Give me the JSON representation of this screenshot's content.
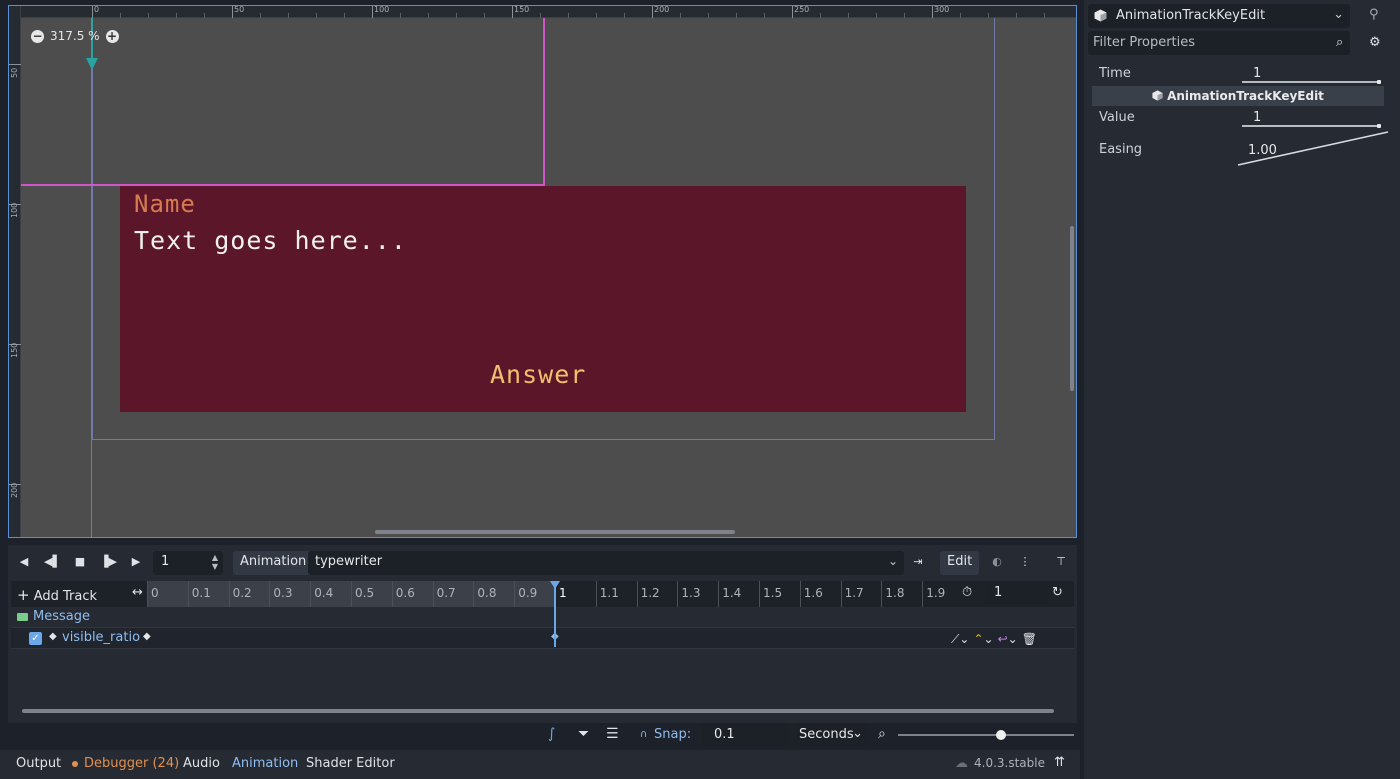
{
  "viewport": {
    "zoom_label": "317.5 %",
    "ruler_top_labels": [
      "0",
      "50",
      "100",
      "150",
      "200",
      "250",
      "300"
    ],
    "ruler_left_labels": [
      "50",
      "100",
      "150",
      "200"
    ],
    "dialog": {
      "name": "Name",
      "text": "Text goes here...",
      "answer": "Answer",
      "bg_color": "#5b1729",
      "name_color": "#d77a52",
      "answer_color": "#f0c070"
    }
  },
  "animation": {
    "toolbar": {
      "frame_value": "1",
      "animation_label": "Animation",
      "animation_name": "typewriter",
      "edit_label": "Edit"
    },
    "timeline": {
      "add_track_label": "Add Track",
      "ticks": [
        "0",
        "0.1",
        "0.2",
        "0.3",
        "0.4",
        "0.5",
        "0.6",
        "0.7",
        "0.8",
        "0.9",
        "1",
        "1.1",
        "1.2",
        "1.3",
        "1.4",
        "1.5",
        "1.6",
        "1.7",
        "1.8",
        "1.9"
      ],
      "length_value": "1",
      "playhead_time": 1.0
    },
    "tracks": {
      "node_name": "Message",
      "property_name": "visible_ratio",
      "keys": [
        0,
        1
      ]
    }
  },
  "bottom_tools": {
    "snap_label": "Snap:",
    "snap_value": "0.1",
    "time_unit": "Seconds"
  },
  "dock_tabs": {
    "output": "Output",
    "debugger": "Debugger (24)",
    "audio": "Audio",
    "animation": "Animation",
    "shader_editor": "Shader Editor",
    "version": "4.0.3.stable"
  },
  "inspector": {
    "object_name": "AnimationTrackKeyEdit",
    "filter_placeholder": "Filter Properties",
    "section_title": "AnimationTrackKeyEdit",
    "properties": {
      "time_label": "Time",
      "time_value": "1",
      "value_label": "Value",
      "value_value": "1",
      "easing_label": "Easing",
      "easing_value": "1.00"
    }
  },
  "colors": {
    "accent": "#6aa8e8",
    "guide_pink": "#cf55c9",
    "panel_bg": "#262a33"
  }
}
